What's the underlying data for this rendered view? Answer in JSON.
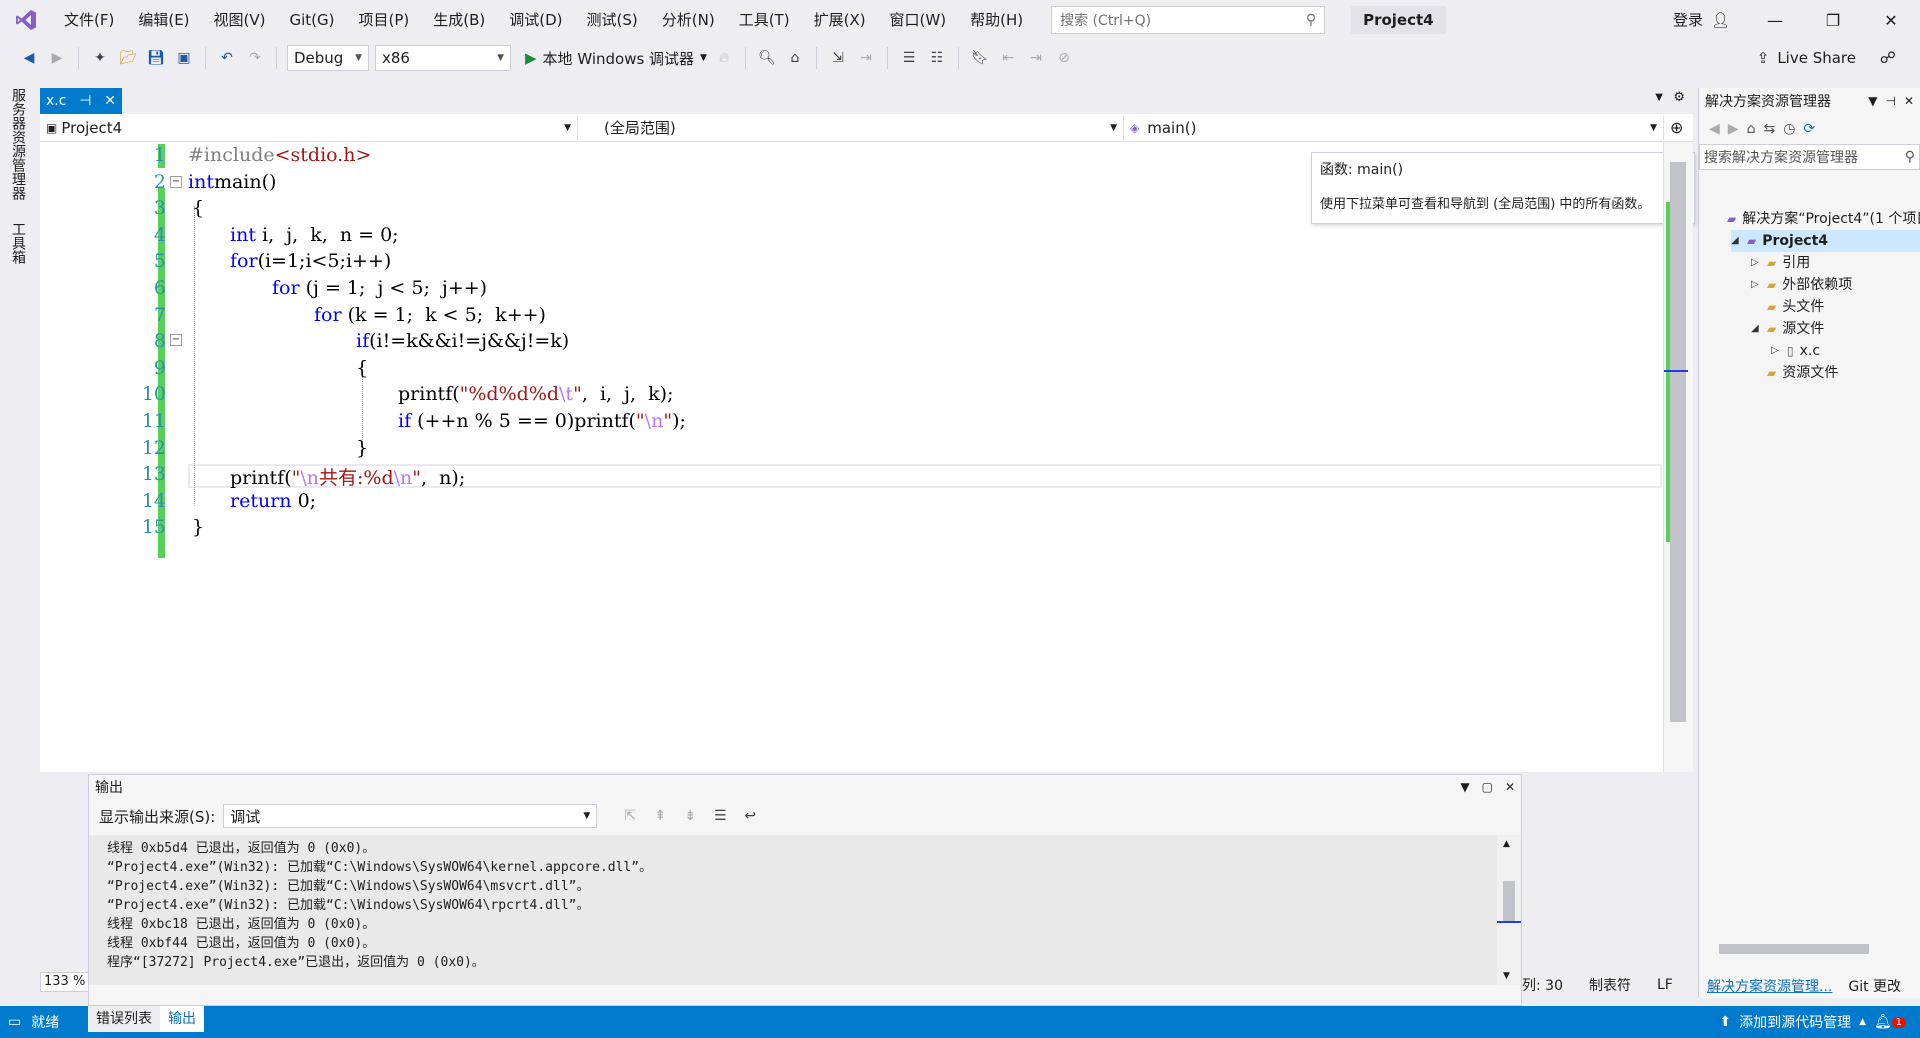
{
  "menubar": {
    "items": [
      "文件(F)",
      "编辑(E)",
      "视图(V)",
      "Git(G)",
      "项目(P)",
      "生成(B)",
      "调试(D)",
      "测试(S)",
      "分析(N)",
      "工具(T)",
      "扩展(X)",
      "窗口(W)",
      "帮助(H)"
    ],
    "search_placeholder": "搜索 (Ctrl+Q)",
    "project_title": "Project4",
    "login": "登录"
  },
  "toolbar": {
    "config": "Debug",
    "platform": "x86",
    "debugger": "本地 Windows 调试器",
    "live_share": "Live Share"
  },
  "left_strip": {
    "tab1": "服务器资源管理器",
    "tab2": "工具箱"
  },
  "doc_tab": {
    "name": "x.c"
  },
  "navbar": {
    "project": "Project4",
    "scope": "(全局范围)",
    "member": "main()"
  },
  "tooltip": {
    "line1": "函数: main()",
    "line2": "使用下拉菜单可查看和导航到 (全局范围) 中的所有函数。"
  },
  "editor": {
    "line_numbers": [
      "1",
      "2",
      "3",
      "4",
      "5",
      "6",
      "7",
      "8",
      "9",
      "10",
      "11",
      "12",
      "13",
      "14",
      "15"
    ],
    "lines": [
      {
        "parts": [
          [
            "pp",
            "#include"
          ],
          [
            "str",
            "<stdio.h>"
          ]
        ],
        "indent": 0
      },
      {
        "parts": [
          [
            "kw",
            "int"
          ],
          [
            "",
            "main()"
          ]
        ],
        "indent": 0
      },
      {
        "parts": [
          [
            "",
            "{"
          ]
        ],
        "indent": 0
      },
      {
        "parts": [
          [
            "kw",
            "int"
          ],
          [
            "",
            " i,  j,  k,  n = 0;"
          ]
        ],
        "indent": 1
      },
      {
        "parts": [
          [
            "kw",
            "for"
          ],
          [
            "",
            "(i=1;i<5;i++)"
          ]
        ],
        "indent": 1
      },
      {
        "parts": [
          [
            "kw",
            "for"
          ],
          [
            "",
            " (j = 1;  j < 5;  j++)"
          ]
        ],
        "indent": 2
      },
      {
        "parts": [
          [
            "kw",
            "for"
          ],
          [
            "",
            " (k = 1;  k < 5;  k++)"
          ]
        ],
        "indent": 3
      },
      {
        "parts": [
          [
            "kw",
            "if"
          ],
          [
            "",
            "(i!=k&&i!=j&&j!=k)"
          ]
        ],
        "indent": 4
      },
      {
        "parts": [
          [
            "",
            "{"
          ]
        ],
        "indent": 4
      },
      {
        "parts": [
          [
            "",
            "printf("
          ],
          [
            "str",
            "\"%d%d%d"
          ],
          [
            "esc",
            "\\t"
          ],
          [
            "str",
            "\""
          ],
          [
            "",
            ",  i,  j,  k);"
          ]
        ],
        "indent": 5
      },
      {
        "parts": [
          [
            "kw",
            "if"
          ],
          [
            "",
            " (++n % 5 == 0)printf("
          ],
          [
            "str",
            "\""
          ],
          [
            "esc",
            "\\n"
          ],
          [
            "str",
            "\""
          ],
          [
            "",
            ");"
          ]
        ],
        "indent": 5
      },
      {
        "parts": [
          [
            "",
            "}"
          ]
        ],
        "indent": 4
      },
      {
        "parts": [
          [
            "",
            "printf("
          ],
          [
            "str",
            "\""
          ],
          [
            "esc",
            "\\n"
          ],
          [
            "str",
            "共有:%d"
          ],
          [
            "esc",
            "\\n"
          ],
          [
            "str",
            "\""
          ],
          [
            "",
            ",  n);"
          ]
        ],
        "indent": 1
      },
      {
        "parts": [
          [
            "kw",
            "return"
          ],
          [
            "",
            " 0;"
          ]
        ],
        "indent": 1
      },
      {
        "parts": [
          [
            "",
            "}"
          ]
        ],
        "indent": 0
      }
    ],
    "zoom": "133 %"
  },
  "output": {
    "title": "输出",
    "source_label": "显示输出来源(S):",
    "source_value": "调试",
    "lines": [
      "线程 0xb5d4 已退出，返回值为 0 (0x0)。",
      "“Project4.exe”(Win32): 已加载“C:\\Windows\\SysWOW64\\kernel.appcore.dll”。",
      "“Project4.exe”(Win32): 已加载“C:\\Windows\\SysWOW64\\msvcrt.dll”。",
      "“Project4.exe”(Win32): 已加载“C:\\Windows\\SysWOW64\\rpcrt4.dll”。",
      "线程 0xbc18 已退出，返回值为 0 (0x0)。",
      "线程 0xbf44 已退出，返回值为 0 (0x0)。",
      "程序“[37272] Project4.exe”已退出，返回值为 0 (0x0)。"
    ]
  },
  "solution": {
    "title": "解决方案资源管理器",
    "search_placeholder": "搜索解决方案资源管理器",
    "items": [
      {
        "label": "解决方案“Project4”(1 个项目)",
        "level": 0,
        "twisty": ""
      },
      {
        "label": "Project4",
        "level": 1,
        "twisty": "◢",
        "selected": true,
        "bold": true
      },
      {
        "label": "引用",
        "level": 2,
        "twisty": "▷"
      },
      {
        "label": "外部依赖项",
        "level": 2,
        "twisty": "▷"
      },
      {
        "label": "头文件",
        "level": 2,
        "twisty": ""
      },
      {
        "label": "源文件",
        "level": 2,
        "twisty": "◢"
      },
      {
        "label": "x.c",
        "level": 3,
        "twisty": "▷"
      },
      {
        "label": "资源文件",
        "level": 2,
        "twisty": ""
      }
    ],
    "tab_active": "解决方案资源管理...",
    "tab_other": "Git 更改"
  },
  "status": {
    "ready": "就绪",
    "col": "列: 30",
    "tab": "制表符",
    "eol": "LF",
    "source_control": "添加到源代码管理",
    "notifications": "1"
  },
  "bottom_tabs": {
    "errors": "错误列表",
    "output": "输出"
  }
}
